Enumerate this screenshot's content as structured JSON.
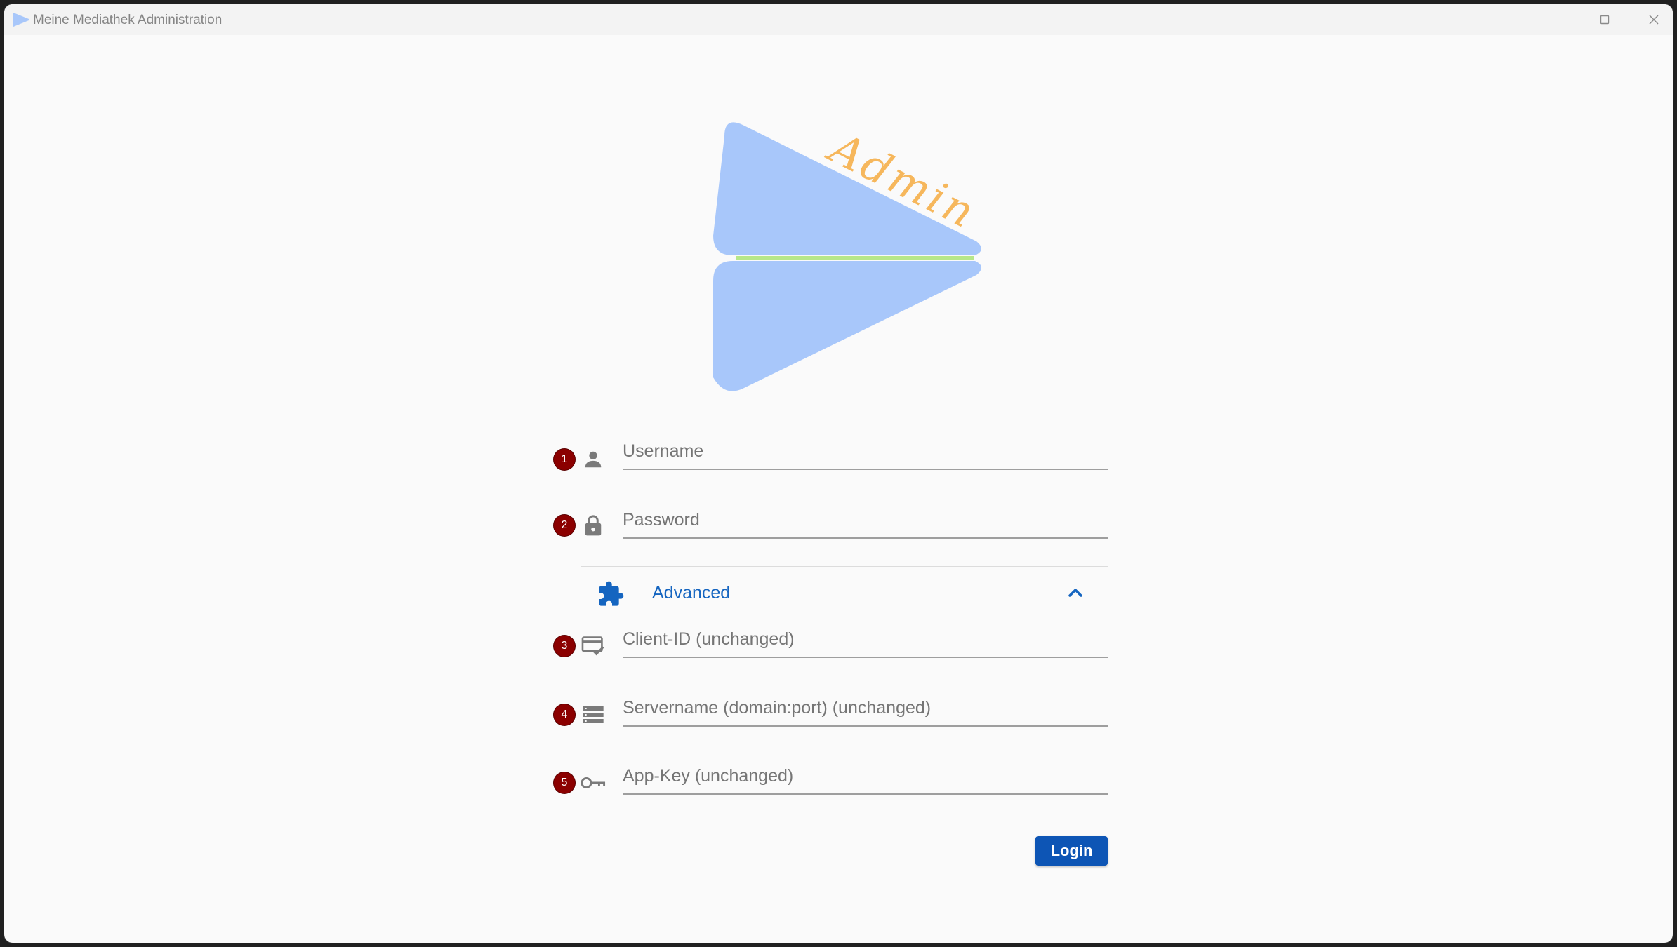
{
  "window": {
    "title": "Meine Mediathek Administration"
  },
  "logo": {
    "word": "Admin",
    "colors": {
      "triangle": "#a8c7fa",
      "divider": "#b7e78a",
      "script": "#f6b75c"
    }
  },
  "form": {
    "fields": [
      {
        "number": "1",
        "icon": "person-icon",
        "placeholder": "Username",
        "value": ""
      },
      {
        "number": "2",
        "icon": "lock-icon",
        "placeholder": "Password",
        "value": ""
      },
      {
        "number": "3",
        "icon": "client-card-icon",
        "placeholder": "Client-ID (unchanged)",
        "value": ""
      },
      {
        "number": "4",
        "icon": "server-list-icon",
        "placeholder": "Servername (domain:port) (unchanged)",
        "value": ""
      },
      {
        "number": "5",
        "icon": "key-icon",
        "placeholder": "App-Key (unchanged)",
        "value": ""
      }
    ],
    "advanced": {
      "label": "Advanced",
      "icon": "puzzle-icon",
      "expanded": true
    },
    "login_label": "Login"
  },
  "colors": {
    "accent": "#1565c0",
    "button": "#0d55b5",
    "badge": "#8b0000",
    "icon_gray": "#7a7a7a"
  }
}
